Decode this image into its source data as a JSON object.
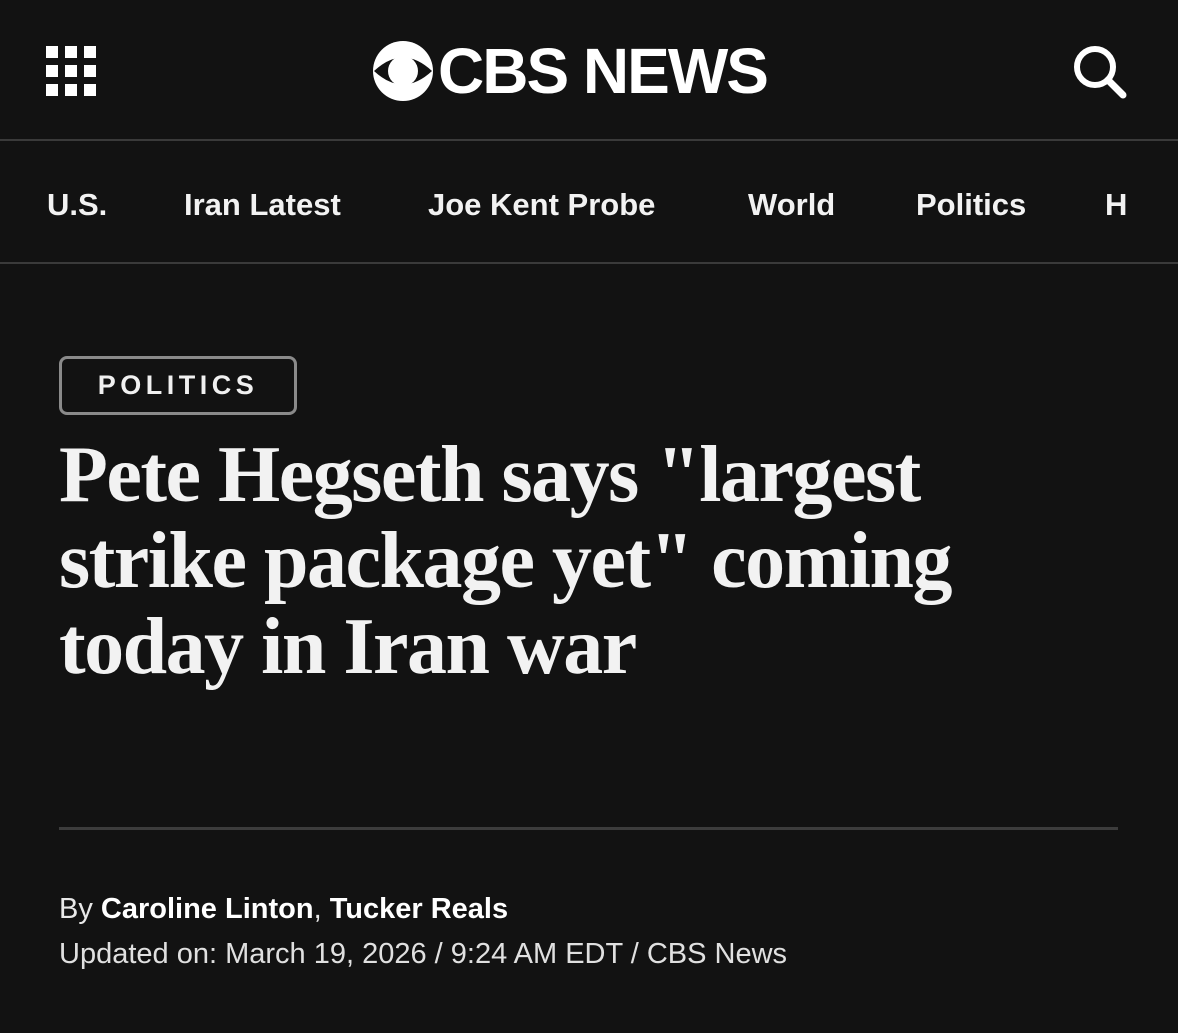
{
  "header": {
    "logo_text": "CBS NEWS",
    "menu_icon": "grid-menu-icon",
    "search_icon": "search-icon"
  },
  "nav": {
    "items": [
      {
        "label": "U.S."
      },
      {
        "label": "Iran Latest"
      },
      {
        "label": "Joe Kent Probe"
      },
      {
        "label": "World"
      },
      {
        "label": "Politics"
      },
      {
        "label": "H"
      }
    ]
  },
  "article": {
    "category": "POLITICS",
    "headline": "Pete Hegseth says \"largest strike package yet\" coming today in Iran war",
    "byline": {
      "prefix": "By ",
      "authors": [
        "Caroline Linton",
        "Tucker Reals"
      ],
      "separator": ", "
    },
    "updated": "Updated on: March 19, 2026 / 9:24 AM EDT / CBS News"
  },
  "colors": {
    "background": "#121212",
    "text": "#ffffff",
    "divider": "#3a3a3a",
    "pill_border": "#8a8a8a"
  }
}
